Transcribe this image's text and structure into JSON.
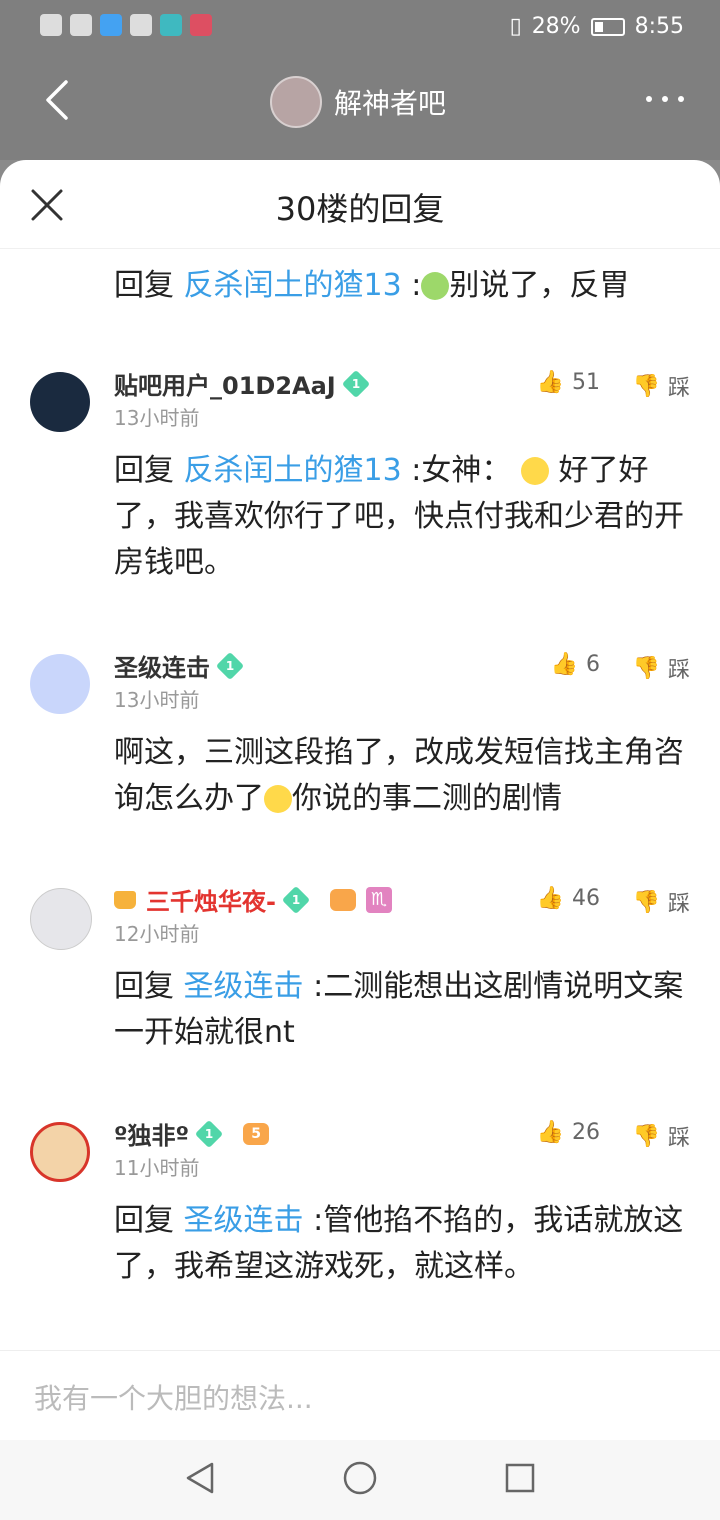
{
  "status_bar": {
    "battery": "28%",
    "time": "8:55"
  },
  "top_nav": {
    "forum_name": "解神者吧"
  },
  "sheet": {
    "title": "30楼的回复",
    "top_reply": {
      "prefix": "回复",
      "target": "反杀闰土的猹13",
      "text": "别说了，反胃"
    }
  },
  "replies": [
    {
      "username": "贴吧用户_01D2AaJ",
      "level": "1",
      "time": "13小时前",
      "likes": "51",
      "dislike_label": "踩",
      "prefix": "回复",
      "target": "反杀闰土的猹13",
      "text": ":女神：",
      "text2": "好了好了，我喜欢你行了吧，快点付我和少君的开房钱吧。"
    },
    {
      "username": "圣级连击",
      "level": "1",
      "time": "13小时前",
      "likes": "6",
      "dislike_label": "踩",
      "text": "啊这，三测这段掐了，改成发短信找主角咨询怎么办了",
      "text2": "你说的事二测的剧情"
    },
    {
      "username": "三千烛华夜-",
      "level": "1",
      "time": "12小时前",
      "likes": "46",
      "dislike_label": "踩",
      "zodiac": "♏",
      "prefix": "回复",
      "target": "圣级连击",
      "text": ":二测能想出这剧情说明文案一开始就很nt"
    },
    {
      "username": "º独非º",
      "level": "1",
      "emblem_level": "5",
      "time": "11小时前",
      "likes": "26",
      "dislike_label": "踩",
      "prefix": "回复",
      "target": "圣级连击",
      "text": ":管他掐不掐的，我话就放这了，我希望这游戏死，就这样。"
    }
  ],
  "input": {
    "placeholder": "我有一个大胆的想法..."
  },
  "colors": {
    "link": "#3a9ee6",
    "level_badge": "#51d6a9",
    "red_username": "#e3342f"
  }
}
